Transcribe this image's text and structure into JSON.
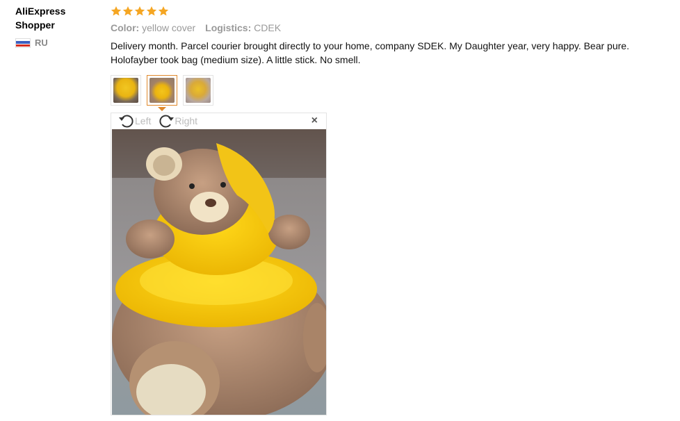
{
  "user": {
    "name": "AliExpress Shopper",
    "country": "RU"
  },
  "review": {
    "rating": 5,
    "rating_max": 5,
    "color_label": "Color:",
    "color_value": "yellow cover",
    "logistics_label": "Logistics:",
    "logistics_value": "CDEK",
    "text": "Delivery month. Parcel courier brought directly to your home, company SDEK. My Daughter year, very happy. Bear pure. Holofayber took bag (medium size). A little stick. No smell."
  },
  "viewer": {
    "rotate_left_label": "Left",
    "rotate_right_label": "Right",
    "close_glyph": "×",
    "active_thumb": 1
  },
  "colors": {
    "star": "#f5a623",
    "active_border": "#e0882a",
    "muted_text": "#999999"
  }
}
